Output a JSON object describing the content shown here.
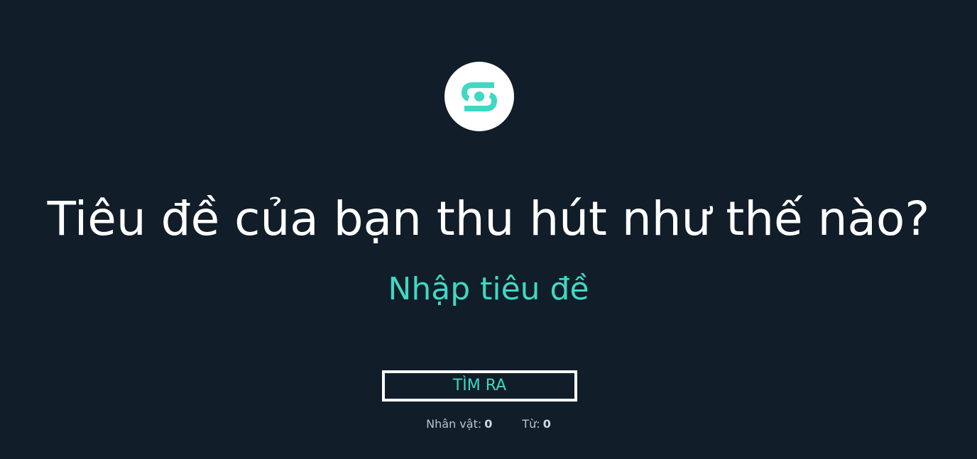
{
  "logo": {
    "icon": "teal-swirl-logo-icon",
    "accent_color": "#3fd8c2"
  },
  "headline": "Tiêu đề của bạn thu hút như thế nào?",
  "title_input": {
    "placeholder": "Nhập tiêu đề",
    "value": ""
  },
  "find_button": {
    "label": "TÌM RA"
  },
  "stats": {
    "characters_label": "Nhân vật:",
    "characters_value": "0",
    "words_label": "Từ:",
    "words_value": "0"
  },
  "colors": {
    "background": "#111d29",
    "accent": "#3fd8c2",
    "text": "#ffffff"
  }
}
